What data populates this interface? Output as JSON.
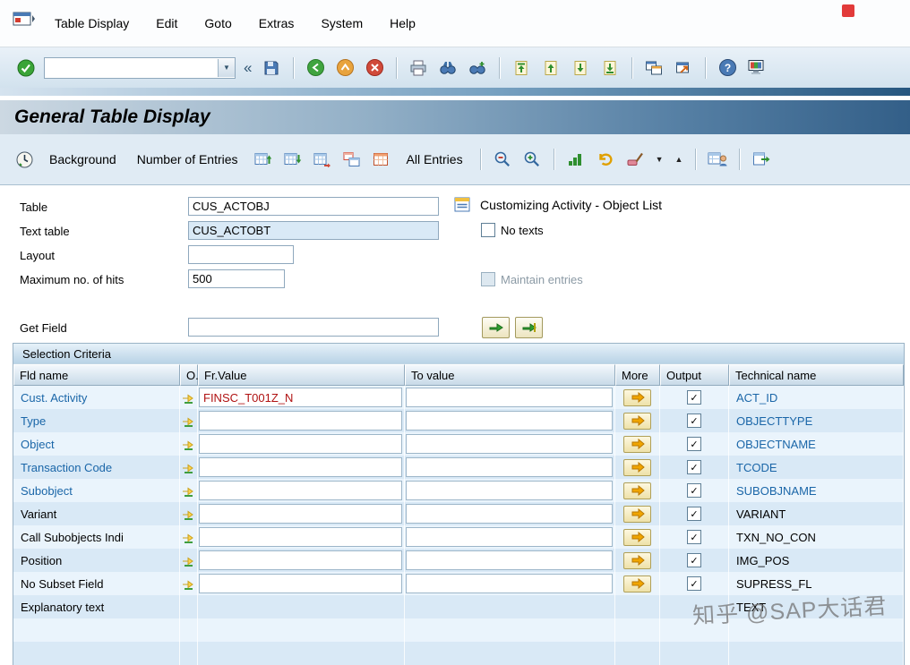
{
  "chrome": {
    "menu": [
      "Table Display",
      "Edit",
      "Goto",
      "Extras",
      "System",
      "Help"
    ],
    "command_value": ""
  },
  "title": "General Table Display",
  "app_toolbar": {
    "background": "Background",
    "number_of_entries": "Number of Entries",
    "all_entries": "All Entries"
  },
  "form": {
    "table": {
      "label": "Table",
      "value": "CUS_ACTOBJ"
    },
    "text_table": {
      "label": "Text table",
      "value": "CUS_ACTOBT"
    },
    "layout": {
      "label": "Layout",
      "value": ""
    },
    "max_hits": {
      "label": "Maximum no. of hits",
      "value": "500"
    },
    "get_field": {
      "label": "Get Field",
      "value": ""
    },
    "description": "Customizing Activity - Object List",
    "no_texts_label": "No texts",
    "maintain_entries_label": "Maintain entries"
  },
  "selection": {
    "header": "Selection Criteria",
    "columns": [
      "Fld name",
      "O.",
      "Fr.Value",
      "To value",
      "More",
      "Output",
      "Technical name"
    ],
    "rows": [
      {
        "field": "Cust. Activity",
        "from": "FINSC_T001Z_N",
        "to": "",
        "technical": "ACT_ID"
      },
      {
        "field": "Type",
        "from": "",
        "to": "",
        "technical": "OBJECTTYPE"
      },
      {
        "field": "Object",
        "from": "",
        "to": "",
        "technical": "OBJECTNAME"
      },
      {
        "field": "Transaction Code",
        "from": "",
        "to": "",
        "technical": "TCODE"
      },
      {
        "field": "Subobject",
        "from": "",
        "to": "",
        "technical": "SUBOBJNAME"
      },
      {
        "field": "Variant",
        "from": "",
        "to": "",
        "technical": "VARIANT"
      },
      {
        "field": "Call Subobjects Indi",
        "from": "",
        "to": "",
        "technical": "TXN_NO_CON"
      },
      {
        "field": "Position",
        "from": "",
        "to": "",
        "technical": "IMG_POS"
      },
      {
        "field": "No Subset Field",
        "from": "",
        "to": "",
        "technical": "SUPRESS_FL"
      },
      {
        "field": "Explanatory text",
        "technical": "TEXT"
      }
    ]
  },
  "watermark": "知乎 @SAP大话君",
  "colors": {
    "link": "#1a66a8",
    "value_text": "#b01212",
    "title_bar": "#335f88",
    "toolbar_bg": "#d2e2ee"
  }
}
